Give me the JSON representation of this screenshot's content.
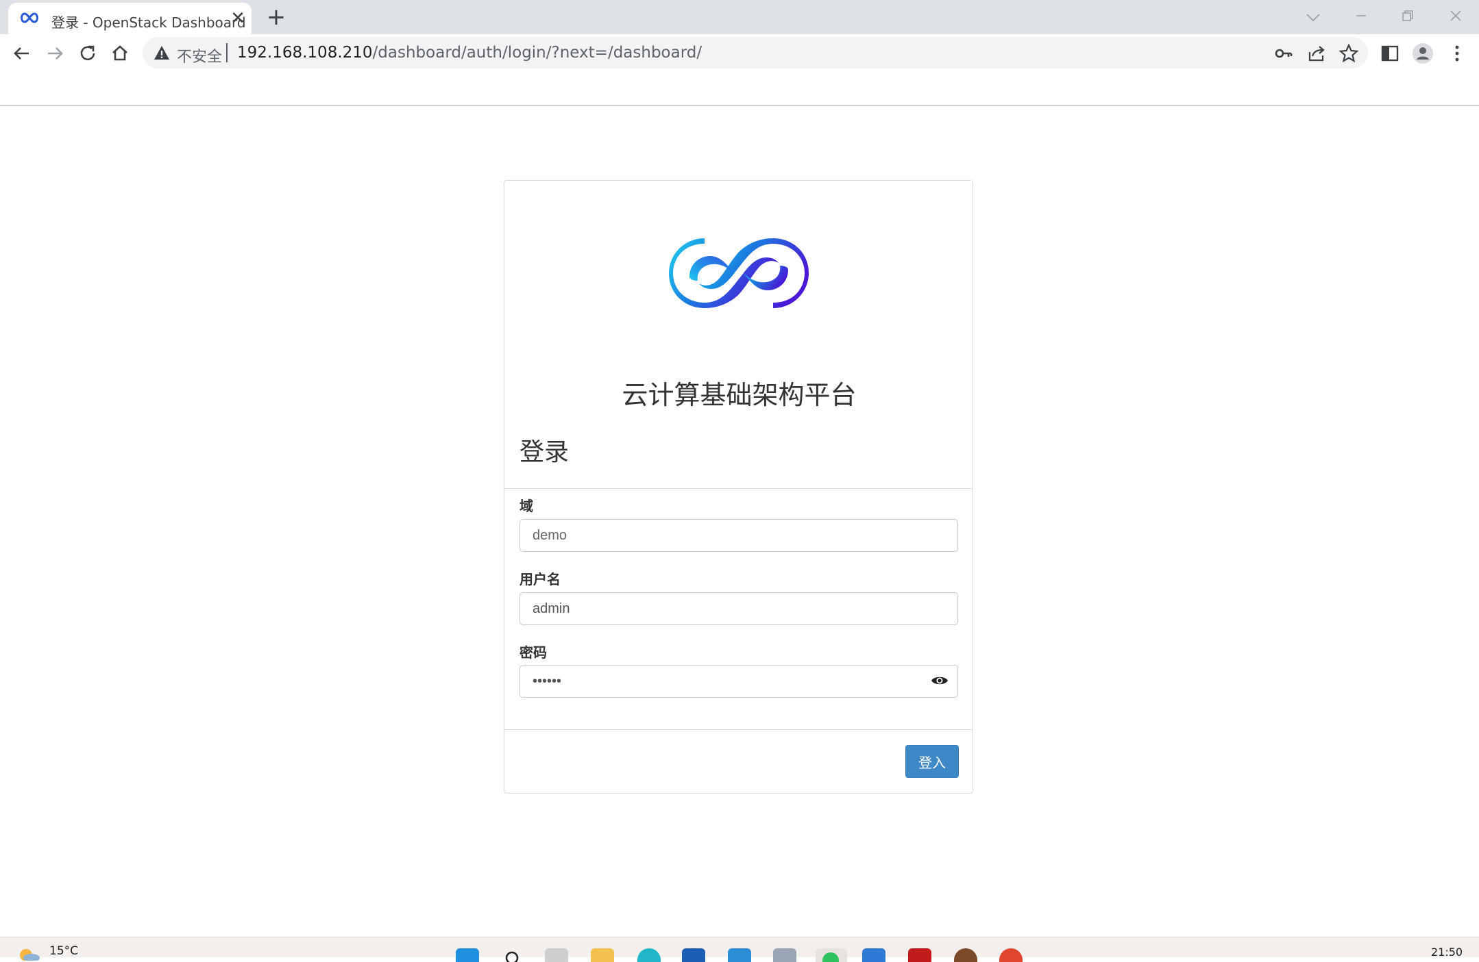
{
  "browser": {
    "tab_title": "登录 - OpenStack Dashboard",
    "tab_close": "✕",
    "new_tab": "+",
    "security_label": "不安全",
    "url_host": "192.168.108.210",
    "url_path": "/dashboard/auth/login/?next=/dashboard/"
  },
  "page": {
    "brand_title": "云计算基础架构平台",
    "login_heading": "登录",
    "domain_label": "域",
    "domain_placeholder": "demo",
    "username_label": "用户名",
    "username_value": "admin",
    "password_label": "密码",
    "password_value": "••••••",
    "signin_label": "登入"
  },
  "taskbar": {
    "weather": "15°C",
    "clock": "21:50"
  },
  "colors": {
    "primary_button": "#3f88c8",
    "logo_gradient_start": "#1fd3f0",
    "logo_gradient_end": "#4a18d6"
  }
}
